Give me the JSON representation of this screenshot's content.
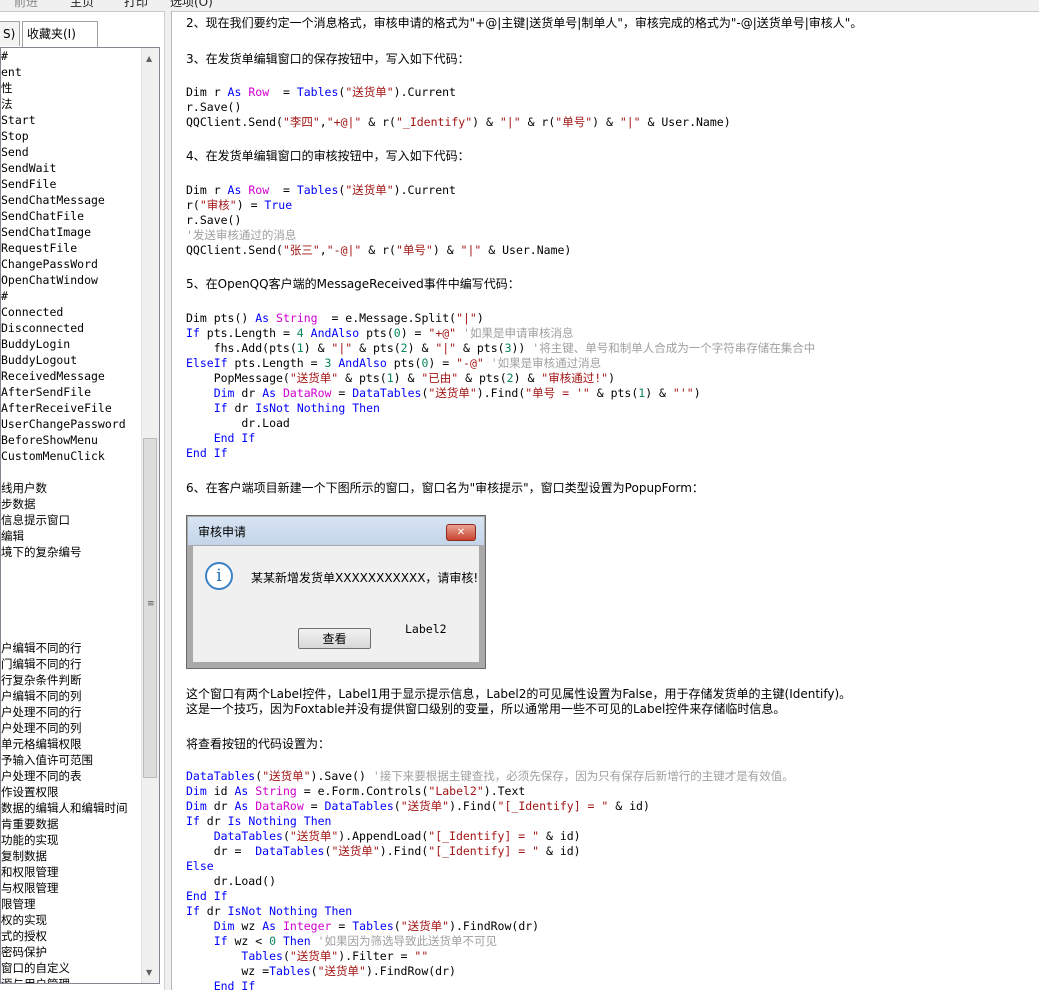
{
  "toolbar": {
    "back": "前进",
    "home": "主页",
    "print": "打印",
    "options": "选项(O)"
  },
  "tabs": [
    {
      "label": "S)"
    },
    {
      "label": "收藏夹(I)"
    }
  ],
  "left_items": [
    "#",
    "ent",
    "性",
    "法",
    "Start",
    "Stop",
    "Send",
    "SendWait",
    "SendFile",
    "SendChatMessage",
    "SendChatFile",
    "SendChatImage",
    "RequestFile",
    "ChangePassWord",
    "OpenChatWindow",
    "#",
    "Connected",
    "Disconnected",
    "BuddyLogin",
    "BuddyLogout",
    "ReceivedMessage",
    "AfterSendFile",
    "AfterReceiveFile",
    "UserChangePassword",
    "BeforeShowMenu",
    "CustomMenuClick",
    "",
    "线用户数",
    "步数据",
    "信息提示窗口",
    "编辑",
    "境下的复杂编号",
    "",
    "",
    "",
    "",
    "",
    "户编辑不同的行",
    "门编辑不同的行",
    "行复杂条件判断",
    "户编辑不同的列",
    "户处理不同的行",
    "户处理不同的列",
    "单元格编辑权限",
    "予输入值许可范围",
    "户处理不同的表",
    "作设置权限",
    "数据的编辑人和编辑时间",
    "肯重要数据",
    "功能的实现",
    "复制数据",
    "和权限管理",
    "与权限管理",
    "限管理",
    "权的实现",
    "式的授权",
    "密码保护",
    "窗口的自定义",
    "源与用户管理"
  ],
  "content": {
    "p2": "2、现在我们要约定一个消息格式，审核申请的格式为\"+@|主键|送货单号|制单人\"，审核完成的格式为\"-@|送货单号|审核人\"。",
    "p3": "3、在发货单编辑窗口的保存按钮中，写入如下代码：",
    "p4": "4、在发货单编辑窗口的审核按钮中，写入如下代码：",
    "p5": "5、在OpenQQ客户端的MessageReceived事件中编写代码：",
    "p6": "6、在客户端项目新建一个下图所示的窗口，窗口名为\"审核提示\"，窗口类型设置为PopupForm：",
    "d1": "这个窗口有两个Label控件，Label1用于显示提示信息，Label2的可见属性设置为False，用于存储发货单的主键(Identify)。",
    "d2": "这是一个技巧，因为Foxtable并没有提供窗口级别的变量，所以通常用一些不可见的Label控件来存储临时信息。",
    "p7": "将查看按钮的代码设置为："
  },
  "code1": [
    [
      [
        "Dim r ",
        ""
      ],
      [
        "As",
        "kw"
      ],
      [
        " ",
        ""
      ],
      [
        "Row",
        "ty"
      ],
      [
        "  = ",
        ""
      ],
      [
        "Tables",
        "kw"
      ],
      [
        "(",
        ""
      ],
      [
        "\"送货单\"",
        "st"
      ],
      [
        ").Current",
        ""
      ]
    ],
    [
      [
        "r.Save()",
        ""
      ]
    ],
    [
      [
        "QQClient.Send(",
        ""
      ],
      [
        "\"李四\"",
        "st"
      ],
      [
        ",",
        ""
      ],
      [
        "\"+@|\"",
        "st"
      ],
      [
        " & r(",
        ""
      ],
      [
        "\"_Identify\"",
        "st"
      ],
      [
        ") & ",
        ""
      ],
      [
        "\"|\"",
        "st"
      ],
      [
        " & r(",
        ""
      ],
      [
        "\"单号\"",
        "st"
      ],
      [
        ") & ",
        ""
      ],
      [
        "\"|\"",
        "st"
      ],
      [
        " & User.Name)",
        ""
      ]
    ]
  ],
  "code2": [
    [
      [
        "Dim r ",
        ""
      ],
      [
        "As",
        "kw"
      ],
      [
        " ",
        ""
      ],
      [
        "Row",
        "ty"
      ],
      [
        "  = ",
        ""
      ],
      [
        "Tables",
        "kw"
      ],
      [
        "(",
        ""
      ],
      [
        "\"送货单\"",
        "st"
      ],
      [
        ").Current",
        ""
      ]
    ],
    [
      [
        "r(",
        ""
      ],
      [
        "\"审核\"",
        "st"
      ],
      [
        ") = ",
        ""
      ],
      [
        "True",
        "kw"
      ]
    ],
    [
      [
        "r.Save()",
        ""
      ]
    ],
    [
      [
        "'发送审核通过的消息",
        "cm"
      ]
    ],
    [
      [
        "QQClient.Send(",
        ""
      ],
      [
        "\"张三\"",
        "st"
      ],
      [
        ",",
        ""
      ],
      [
        "\"-@|\"",
        "st"
      ],
      [
        " & r(",
        ""
      ],
      [
        "\"单号\"",
        "st"
      ],
      [
        ") & ",
        ""
      ],
      [
        "\"|\"",
        "st"
      ],
      [
        " & User.Name)",
        ""
      ]
    ]
  ],
  "code3": [
    [
      [
        "Dim pts() ",
        ""
      ],
      [
        "As",
        "kw"
      ],
      [
        " ",
        ""
      ],
      [
        "String",
        "ty"
      ],
      [
        "  = e.Message.Split(",
        ""
      ],
      [
        "\"|\"",
        "st"
      ],
      [
        ")",
        ""
      ]
    ],
    [
      [
        "If",
        "kw"
      ],
      [
        " pts.Length = ",
        ""
      ],
      [
        "4",
        "nm"
      ],
      [
        " ",
        ""
      ],
      [
        "AndAlso",
        "kw"
      ],
      [
        " pts(",
        ""
      ],
      [
        "0",
        "nm"
      ],
      [
        ") = ",
        ""
      ],
      [
        "\"+@\"",
        "st"
      ],
      [
        " ",
        ""
      ],
      [
        "'如果是申请审核消息",
        "cm"
      ]
    ],
    [
      [
        "    fhs.Add(pts(",
        ""
      ],
      [
        "1",
        "nm"
      ],
      [
        ") & ",
        ""
      ],
      [
        "\"|\"",
        "st"
      ],
      [
        " & pts(",
        ""
      ],
      [
        "2",
        "nm"
      ],
      [
        ") & ",
        ""
      ],
      [
        "\"|\"",
        "st"
      ],
      [
        " & pts(",
        ""
      ],
      [
        "3",
        "nm"
      ],
      [
        ")) ",
        ""
      ],
      [
        "'将主键、单号和制单人合成为一个字符串存储在集合中",
        "cm"
      ]
    ],
    [
      [
        "ElseIf",
        "kw"
      ],
      [
        " pts.Length = ",
        ""
      ],
      [
        "3",
        "nm"
      ],
      [
        " ",
        ""
      ],
      [
        "AndAlso",
        "kw"
      ],
      [
        " pts(",
        ""
      ],
      [
        "0",
        "nm"
      ],
      [
        ") = ",
        ""
      ],
      [
        "\"-@\"",
        "st"
      ],
      [
        " ",
        ""
      ],
      [
        "'如果是审核通过消息",
        "cm"
      ]
    ],
    [
      [
        "    PopMessage(",
        ""
      ],
      [
        "\"送货单\"",
        "st"
      ],
      [
        " & pts(",
        ""
      ],
      [
        "1",
        "nm"
      ],
      [
        ") & ",
        ""
      ],
      [
        "\"已由\"",
        "st"
      ],
      [
        " & pts(",
        ""
      ],
      [
        "2",
        "nm"
      ],
      [
        ") & ",
        ""
      ],
      [
        "\"审核通过!\"",
        "st"
      ],
      [
        ")",
        ""
      ]
    ],
    [
      [
        "    ",
        ""
      ],
      [
        "Dim",
        "kw"
      ],
      [
        " dr ",
        ""
      ],
      [
        "As",
        "kw"
      ],
      [
        " ",
        ""
      ],
      [
        "DataRow",
        "ty"
      ],
      [
        " = ",
        ""
      ],
      [
        "DataTables",
        "kw"
      ],
      [
        "(",
        ""
      ],
      [
        "\"送货单\"",
        "st"
      ],
      [
        ").Find(",
        ""
      ],
      [
        "\"单号 = '\"",
        "st"
      ],
      [
        " & pts(",
        ""
      ],
      [
        "1",
        "nm"
      ],
      [
        ") & ",
        ""
      ],
      [
        "\"'\"",
        "st"
      ],
      [
        ")",
        ""
      ]
    ],
    [
      [
        "    ",
        ""
      ],
      [
        "If",
        "kw"
      ],
      [
        " dr ",
        ""
      ],
      [
        "IsNot",
        "kw"
      ],
      [
        " ",
        ""
      ],
      [
        "Nothing",
        "kw"
      ],
      [
        " ",
        ""
      ],
      [
        "Then",
        "kw"
      ]
    ],
    [
      [
        "        dr.Load",
        ""
      ]
    ],
    [
      [
        "    ",
        ""
      ],
      [
        "End If",
        "kw"
      ]
    ],
    [
      [
        "End If",
        "kw"
      ]
    ]
  ],
  "code4": [
    [
      [
        "DataTables",
        "kw"
      ],
      [
        "(",
        ""
      ],
      [
        "\"送货单\"",
        "st"
      ],
      [
        ").Save() ",
        ""
      ],
      [
        "'接下来要根据主键查找，必须先保存，因为只有保存后新增行的主键才是有效值。",
        "cm"
      ]
    ],
    [
      [
        "Dim",
        "kw"
      ],
      [
        " id ",
        ""
      ],
      [
        "As",
        "kw"
      ],
      [
        " ",
        ""
      ],
      [
        "String",
        "ty"
      ],
      [
        " = e.Form.Controls(",
        ""
      ],
      [
        "\"Label2\"",
        "st"
      ],
      [
        ").Text",
        ""
      ]
    ],
    [
      [
        "Dim",
        "kw"
      ],
      [
        " dr ",
        ""
      ],
      [
        "As",
        "kw"
      ],
      [
        " ",
        ""
      ],
      [
        "DataRow",
        "ty"
      ],
      [
        " = ",
        ""
      ],
      [
        "DataTables",
        "kw"
      ],
      [
        "(",
        ""
      ],
      [
        "\"送货单\"",
        "st"
      ],
      [
        ").Find(",
        ""
      ],
      [
        "\"[_Identify] = \"",
        "st"
      ],
      [
        " & id)",
        ""
      ]
    ],
    [
      [
        "If",
        "kw"
      ],
      [
        " dr ",
        ""
      ],
      [
        "Is",
        "kw"
      ],
      [
        " ",
        ""
      ],
      [
        "Nothing",
        "kw"
      ],
      [
        " ",
        ""
      ],
      [
        "Then",
        "kw"
      ]
    ],
    [
      [
        "    ",
        ""
      ],
      [
        "DataTables",
        "kw"
      ],
      [
        "(",
        ""
      ],
      [
        "\"送货单\"",
        "st"
      ],
      [
        ").AppendLoad(",
        ""
      ],
      [
        "\"[_Identify] = \"",
        "st"
      ],
      [
        " & id)",
        ""
      ]
    ],
    [
      [
        "    dr =  ",
        ""
      ],
      [
        "DataTables",
        "kw"
      ],
      [
        "(",
        ""
      ],
      [
        "\"送货单\"",
        "st"
      ],
      [
        ").Find(",
        ""
      ],
      [
        "\"[_Identify] = \"",
        "st"
      ],
      [
        " & id)",
        ""
      ]
    ],
    [
      [
        "Else",
        "kw"
      ]
    ],
    [
      [
        "    dr.Load()",
        ""
      ]
    ],
    [
      [
        "End If",
        "kw"
      ]
    ],
    [
      [
        "If",
        "kw"
      ],
      [
        " dr ",
        ""
      ],
      [
        "IsNot",
        "kw"
      ],
      [
        " ",
        ""
      ],
      [
        "Nothing",
        "kw"
      ],
      [
        " ",
        ""
      ],
      [
        "Then",
        "kw"
      ]
    ],
    [
      [
        "    ",
        ""
      ],
      [
        "Dim",
        "kw"
      ],
      [
        " wz ",
        ""
      ],
      [
        "As",
        "kw"
      ],
      [
        " ",
        ""
      ],
      [
        "Integer",
        "ty"
      ],
      [
        " = ",
        ""
      ],
      [
        "Tables",
        "kw"
      ],
      [
        "(",
        ""
      ],
      [
        "\"送货单\"",
        "st"
      ],
      [
        ").FindRow(dr)",
        ""
      ]
    ],
    [
      [
        "    ",
        ""
      ],
      [
        "If",
        "kw"
      ],
      [
        " wz < ",
        ""
      ],
      [
        "0",
        "nm"
      ],
      [
        " ",
        ""
      ],
      [
        "Then",
        "kw"
      ],
      [
        " ",
        ""
      ],
      [
        "'如果因为筛选导致此送货单不可见",
        "cm"
      ]
    ],
    [
      [
        "        ",
        ""
      ],
      [
        "Tables",
        "kw"
      ],
      [
        "(",
        ""
      ],
      [
        "\"送货单\"",
        "st"
      ],
      [
        ").Filter = ",
        ""
      ],
      [
        "\"\"",
        "st"
      ]
    ],
    [
      [
        "        wz =",
        ""
      ],
      [
        "Tables",
        "kw"
      ],
      [
        "(",
        ""
      ],
      [
        "\"送货单\"",
        "st"
      ],
      [
        ").FindRow(dr)",
        ""
      ]
    ],
    [
      [
        "    ",
        ""
      ],
      [
        "End If",
        "kw"
      ]
    ]
  ],
  "dialog": {
    "title": "审核申请",
    "close": "✕",
    "icon": "i",
    "message": "某某新增发货单XXXXXXXXXXX，请审核!",
    "label2": "Label2",
    "button": "查看"
  }
}
